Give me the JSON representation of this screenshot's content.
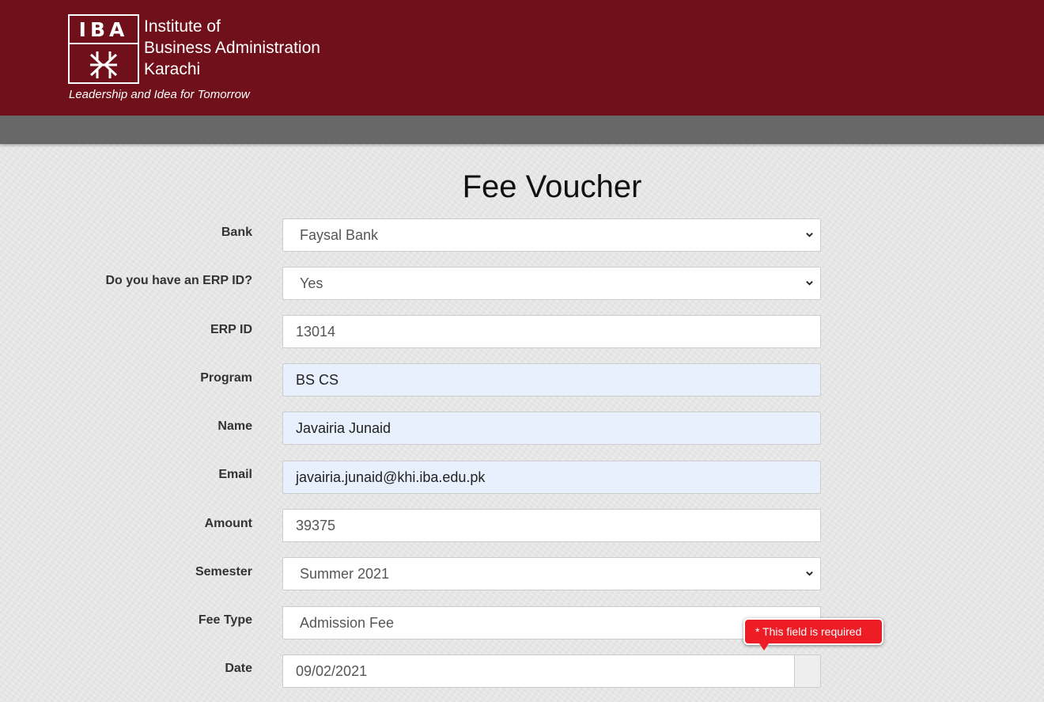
{
  "header": {
    "logo_text": "IBA",
    "institute_lines": [
      "Institute of",
      "Business Administration",
      "Karachi"
    ],
    "tagline": "Leadership and Idea for Tomorrow",
    "colors": {
      "brand": "#70101a",
      "navbar": "#686868"
    }
  },
  "form": {
    "title": "Fee Voucher",
    "fields": [
      {
        "label": "Bank",
        "value": "Faysal Bank",
        "type": "select"
      },
      {
        "label": "Do you have an ERP ID?",
        "value": "Yes",
        "type": "select"
      },
      {
        "label": "ERP ID",
        "value": "13014",
        "type": "text"
      },
      {
        "label": "Program",
        "value": "BS CS",
        "type": "text",
        "autofilled": true
      },
      {
        "label": "Name",
        "value": "Javairia Junaid",
        "type": "text",
        "autofilled": true
      },
      {
        "label": "Email",
        "value": "javairia.junaid@khi.iba.edu.pk",
        "type": "text",
        "autofilled": true
      },
      {
        "label": "Amount",
        "value": "39375",
        "type": "text"
      },
      {
        "label": "Semester",
        "value": "Summer 2021",
        "type": "select"
      },
      {
        "label": "Fee Type",
        "value": "Admission Fee",
        "type": "select"
      },
      {
        "label": "Date",
        "value": "09/02/2021",
        "type": "date"
      }
    ],
    "validation": {
      "message": "* This field is required",
      "color": "#ee1c25"
    }
  }
}
